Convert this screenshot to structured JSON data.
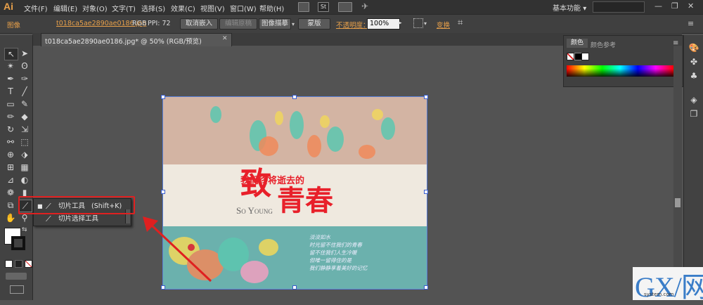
{
  "app": {
    "logo": "Ai"
  },
  "menu": [
    "文件(F)",
    "编辑(E)",
    "对象(O)",
    "文字(T)",
    "选择(S)",
    "效果(C)",
    "视图(V)",
    "窗口(W)",
    "帮助(H)"
  ],
  "toolbar_icons": {
    "st_label": "St"
  },
  "workspace": {
    "label": "基本功能",
    "chevron": "▾"
  },
  "window_controls": {
    "minimize": "—",
    "restore": "❐",
    "close": "✕"
  },
  "control_bar": {
    "selection_type": "图像",
    "filename": "t018ca5ae2890ae0186.jpg",
    "color_mode": "RGB",
    "ppi": "PPI: 72",
    "buttons": {
      "unembed": "取消嵌入",
      "edit_original": "编辑原稿",
      "image_trace": "图像描摹",
      "mask": "蒙版",
      "transform": "变换"
    },
    "opacity_label": "不透明度：",
    "opacity_value": "100%"
  },
  "document_tab": {
    "title": "t018ca5ae2890ae0186.jpg* @ 50% (RGB/预览)",
    "close": "✕"
  },
  "flyout": {
    "items": [
      {
        "label": "切片工具",
        "shortcut": "(Shift+K)"
      },
      {
        "label": "切片选择工具"
      }
    ]
  },
  "color_panel": {
    "tabs": [
      "颜色",
      "颜色参考"
    ]
  },
  "artwork": {
    "headline_small": "我们终将逝去的",
    "headline_big1": "致",
    "headline_big2": "青春",
    "english": "So Young",
    "poem": [
      "淡淡如水",
      "时光留不住我们的青春",
      "留不住我们人生冷暖",
      "但唯一留得住的是",
      "我们静静享着美好的记忆"
    ]
  },
  "watermark": {
    "main": "GX/网",
    "sub": "system.com"
  },
  "colors": {
    "accent_orange": "#e8a04a",
    "highlight_red": "#e02020",
    "selection_blue": "#3a5fd0"
  }
}
